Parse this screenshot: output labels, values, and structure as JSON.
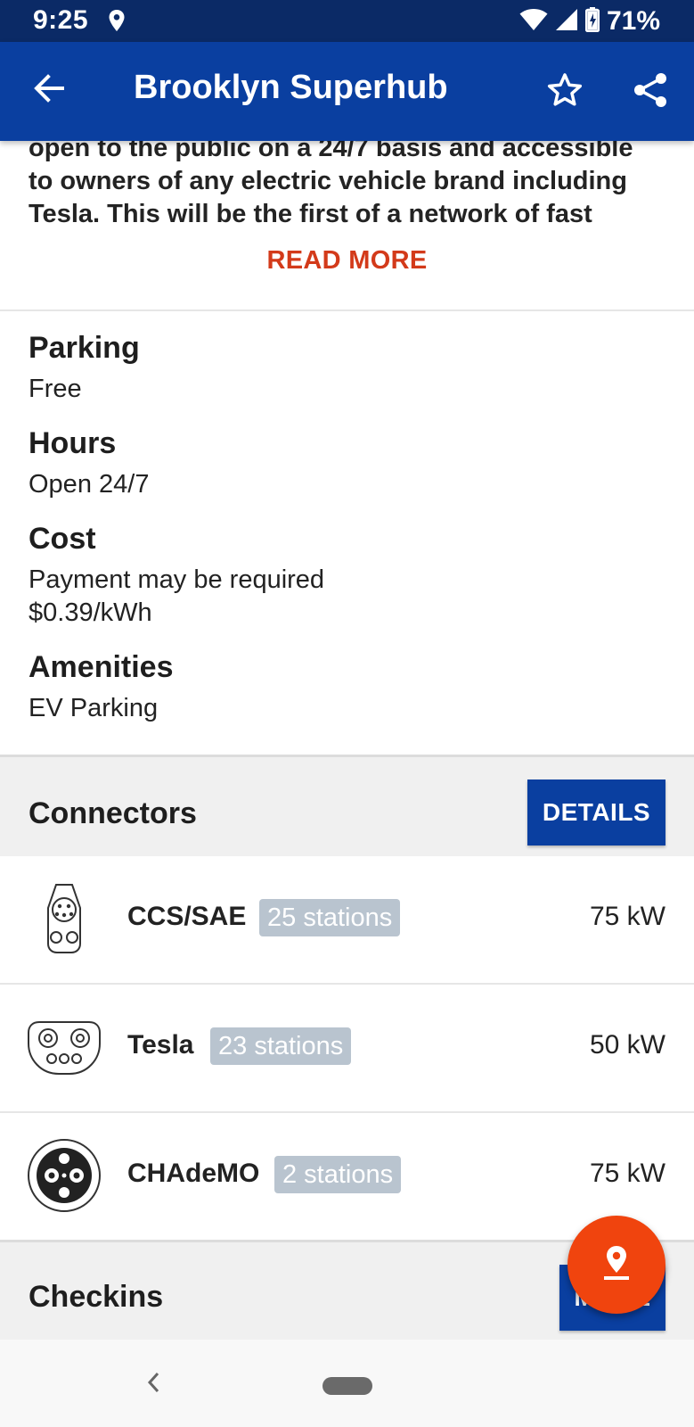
{
  "status_bar": {
    "time": "9:25",
    "battery_percent": "71%",
    "icons": [
      "location-icon",
      "wifi-icon",
      "cell-signal-icon",
      "battery-charging-icon"
    ]
  },
  "app_bar": {
    "title": "Brooklyn Superhub",
    "icons": [
      "back-arrow-icon",
      "star-outline-icon",
      "share-icon"
    ]
  },
  "description": {
    "lines": [
      "open to the public on a 24/7 basis and accessible",
      "to owners of any electric vehicle brand including",
      "Tesla. This will be the first of a network of fast"
    ],
    "read_more": "READ MORE"
  },
  "info": {
    "parking": {
      "label": "Parking",
      "value": "Free"
    },
    "hours": {
      "label": "Hours",
      "value": "Open 24/7"
    },
    "cost": {
      "label": "Cost",
      "value_line1": "Payment may be required",
      "value_line2": "$0.39/kWh"
    },
    "amenities": {
      "label": "Amenities",
      "value": "EV Parking"
    }
  },
  "connectors": {
    "title": "Connectors",
    "details_button": "DETAILS",
    "items": [
      {
        "name": "CCS/SAE",
        "stations": "25 stations",
        "power": "75 kW",
        "icon": "ccs-sae-plug-icon"
      },
      {
        "name": "Tesla",
        "stations": "23 stations",
        "power": "50 kW",
        "icon": "tesla-plug-icon"
      },
      {
        "name": "CHAdeMO",
        "stations": "2 stations",
        "power": "75 kW",
        "icon": "chademo-plug-icon"
      }
    ]
  },
  "checkins": {
    "title": "Checkins",
    "button_label": "MORE"
  },
  "colors": {
    "app_bar": "#0a3fa0",
    "status_bar": "#0b2a66",
    "accent_red": "#d33a1a",
    "fab": "#f0440e",
    "badge": "#b9c4cf"
  }
}
